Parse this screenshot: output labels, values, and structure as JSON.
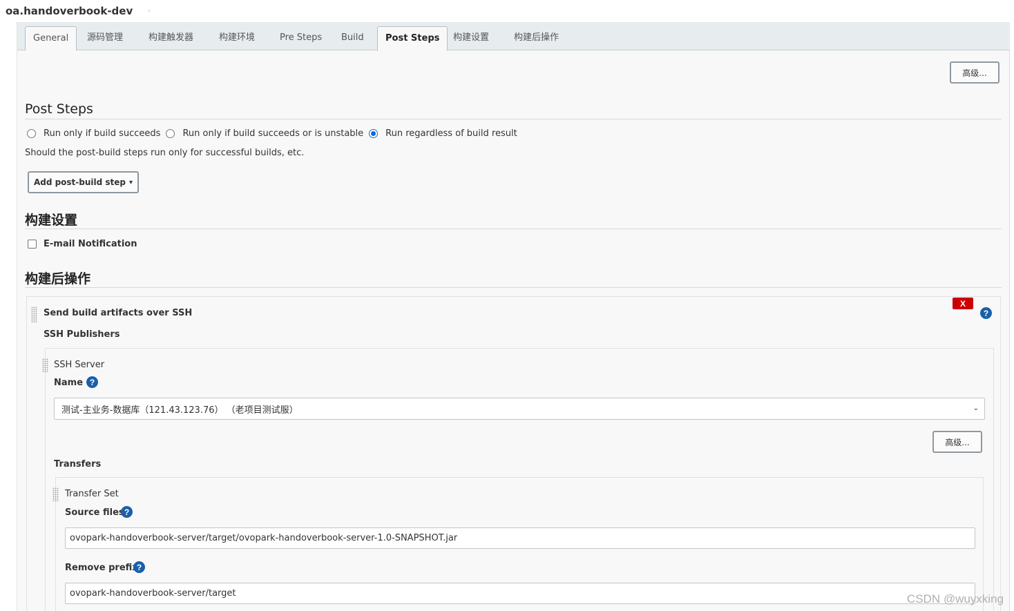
{
  "breadcrumb": {
    "job": "oa.handoverbook-dev",
    "caret": "›"
  },
  "tabs": [
    {
      "label": "General"
    },
    {
      "label": "源码管理"
    },
    {
      "label": "构建触发器"
    },
    {
      "label": "构建环境"
    },
    {
      "label": "Pre Steps"
    },
    {
      "label": "Build"
    },
    {
      "label": "Post Steps"
    },
    {
      "label": "构建设置"
    },
    {
      "label": "构建后操作"
    }
  ],
  "active_tab": "Post Steps",
  "advanced_label": "高级...",
  "post_steps": {
    "title": "Post Steps",
    "options": [
      {
        "label": "Run only if build succeeds",
        "checked": false
      },
      {
        "label": "Run only if build succeeds or is unstable",
        "checked": false
      },
      {
        "label": "Run regardless of build result",
        "checked": true
      }
    ],
    "description": "Should the post-build steps run only for successful builds, etc.",
    "add_button": "Add post-build step",
    "add_caret": "▾"
  },
  "build_settings": {
    "title": "构建设置",
    "email_label": "E-mail Notification",
    "email_checked": false
  },
  "post_build": {
    "title": "构建后操作",
    "delete_label": "X",
    "help_glyph": "?",
    "publisher_title": "Send build artifacts over SSH",
    "ssh_publishers_label": "SSH Publishers",
    "ssh_server_label": "SSH Server",
    "name_label": "Name",
    "name_value": "测试-主业务-数据库（121.43.123.76） （老项目测试服）",
    "select_caret": "⌄",
    "transfers_label": "Transfers",
    "transfer_set_label": "Transfer Set",
    "source_files_label": "Source files",
    "source_files_value": "ovopark-handoverbook-server/target/ovopark-handoverbook-server-1.0-SNAPSHOT.jar",
    "remove_prefix_label": "Remove prefix",
    "remove_prefix_value": "ovopark-handoverbook-server/target"
  },
  "watermark": "CSDN @wuyxking"
}
